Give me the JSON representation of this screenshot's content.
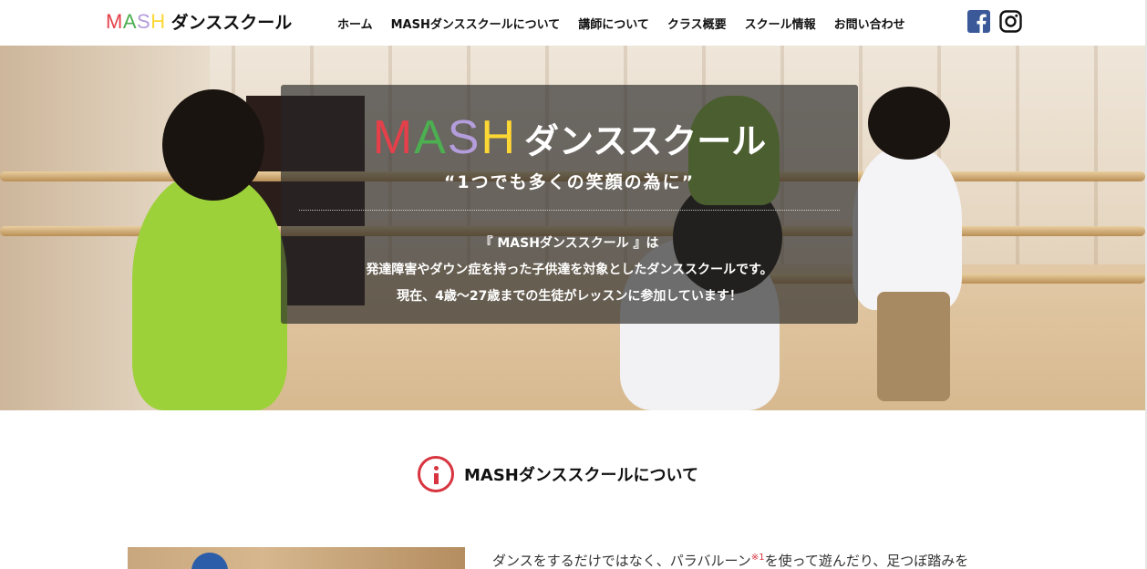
{
  "brand": {
    "letters": [
      {
        "char": "M",
        "color": "#e5404a"
      },
      {
        "char": "A",
        "color": "#4caf50"
      },
      {
        "char": "S",
        "color": "#b39ddb"
      },
      {
        "char": "H",
        "color": "#fdd835"
      }
    ],
    "suffix": "ダンススクール"
  },
  "nav": {
    "items": [
      "ホーム",
      "MASHダンススクールについて",
      "講師について",
      "クラス概要",
      "スクール情報",
      "お問い合わせ"
    ]
  },
  "social": {
    "facebook_icon": "facebook-icon",
    "instagram_icon": "instagram-icon",
    "facebook_color": "#3b5998"
  },
  "hero": {
    "logo_suffix": "ダンススクール",
    "catchphrase": "“1つでも多くの笑顔の為に”",
    "lines": [
      "『 MASHダンススクール 』は",
      "発達障害やダウン症を持った子供達を対象としたダンススクールです。",
      "現在、4歳〜27歳までの生徒がレッスンに参加しています！"
    ]
  },
  "section": {
    "icon": "info-icon",
    "title": "MASHダンススクールについて",
    "paragraph_start": "ダンスをするだけではなく、パラバルーン",
    "footnote": "※1",
    "paragraph_end": "を使って遊んだり、足つぼ踏みを",
    "accent": "#d8343f"
  }
}
